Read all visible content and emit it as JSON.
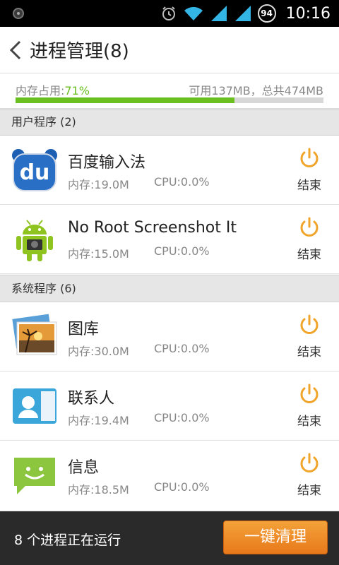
{
  "status_bar": {
    "battery": "94",
    "time": "10:16"
  },
  "header": {
    "title": "进程管理(8)"
  },
  "memory": {
    "label_prefix": "内存占用:",
    "percent_text": "71%",
    "usage_fraction": 0.71,
    "summary": "可用137MB，总共474MB"
  },
  "sections": {
    "user": {
      "label": "用户程序 (2)"
    },
    "system": {
      "label": "系统程序 (6)"
    }
  },
  "apps": [
    {
      "name": "百度输入法",
      "mem": "内存:19.0M",
      "cpu": "CPU:0.0%",
      "end": "结束",
      "icon": "baidu-du-icon"
    },
    {
      "name": "No Root Screenshot It",
      "mem": "内存:15.0M",
      "cpu": "CPU:0.0%",
      "end": "结束",
      "icon": "android-robot-icon"
    },
    {
      "name": "图库",
      "mem": "内存:30.0M",
      "cpu": "CPU:0.0%",
      "end": "结束",
      "icon": "gallery-icon"
    },
    {
      "name": "联系人",
      "mem": "内存:19.4M",
      "cpu": "CPU:0.0%",
      "end": "结束",
      "icon": "contacts-icon"
    },
    {
      "name": "信息",
      "mem": "内存:18.5M",
      "cpu": "CPU:0.0%",
      "end": "结束",
      "icon": "messages-icon"
    }
  ],
  "footer": {
    "status": "8 个进程正在运行",
    "clean_button": "一键清理"
  },
  "colors": {
    "accent_green": "#6bbf1e",
    "power_orange": "#f0a42a",
    "button_orange": "#e8791b"
  }
}
